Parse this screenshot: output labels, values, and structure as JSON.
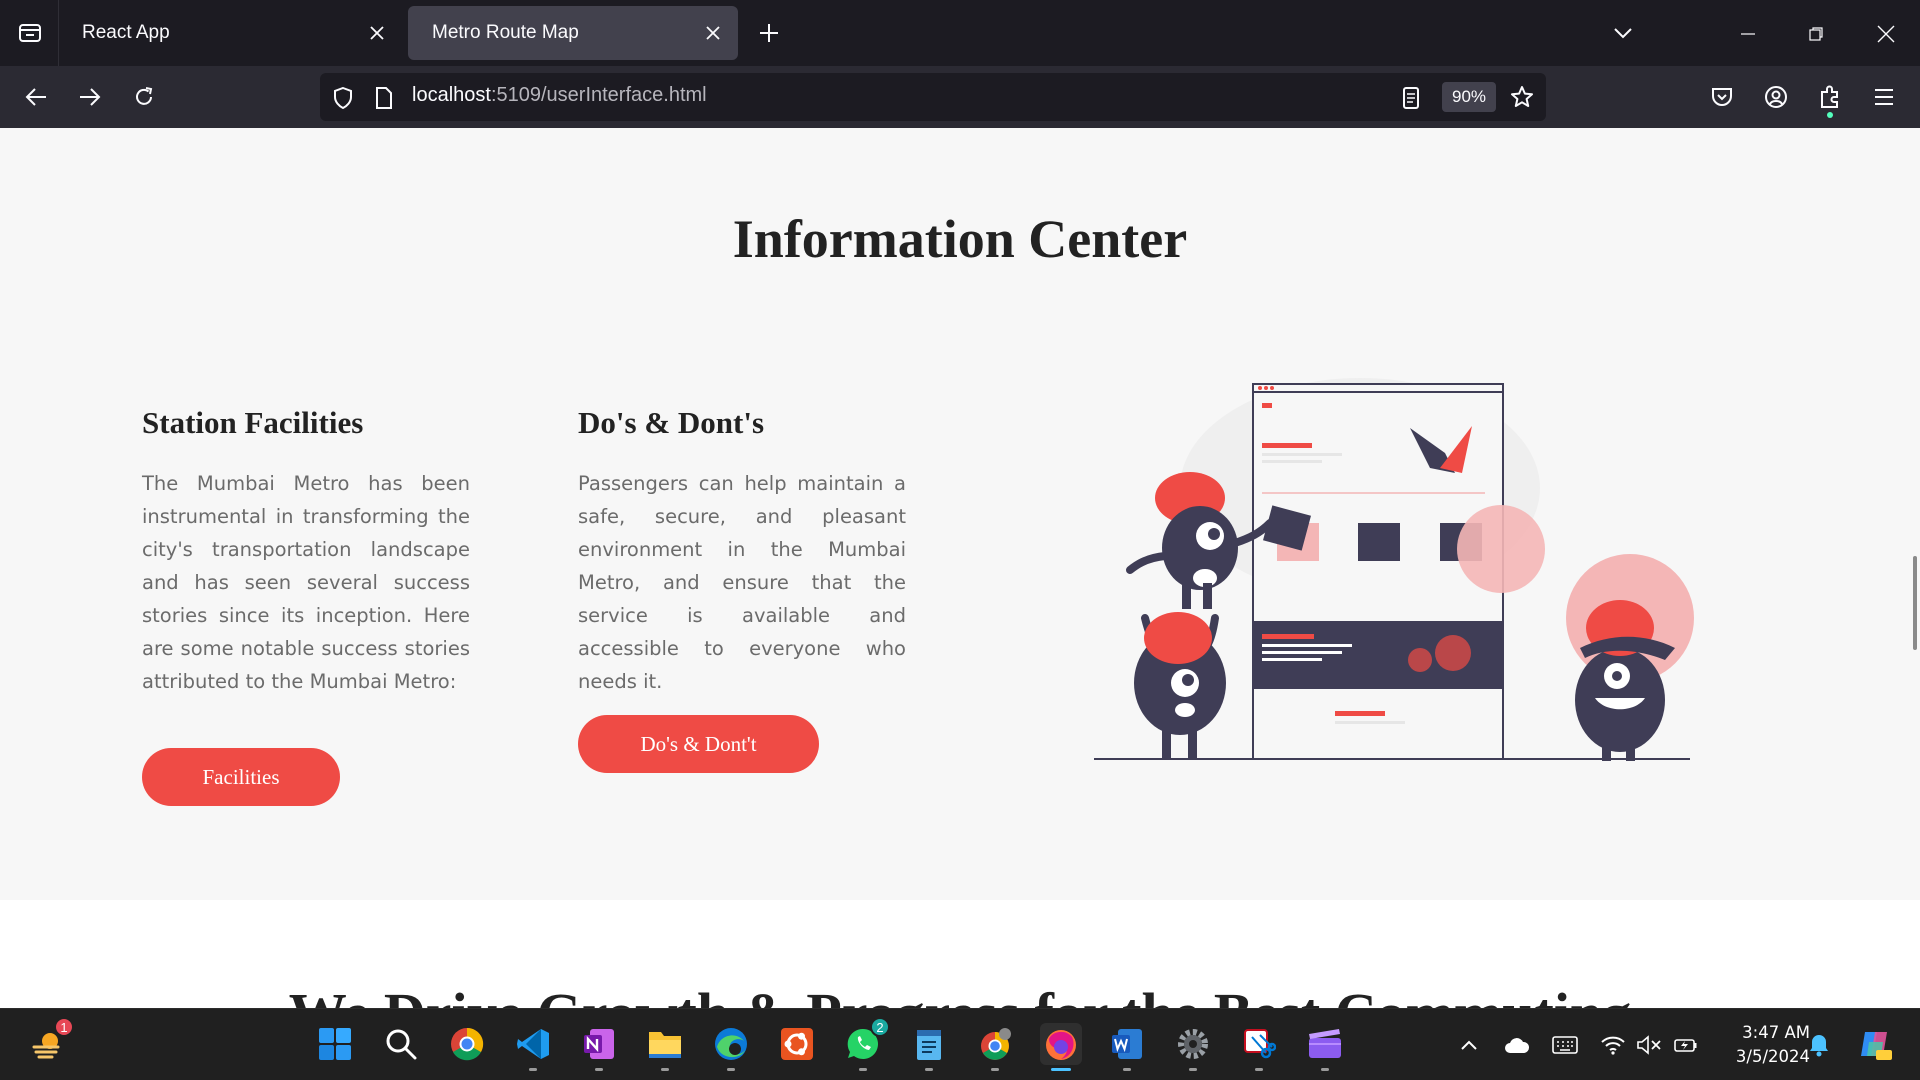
{
  "browser": {
    "tabs": [
      {
        "label": "React App",
        "active": false
      },
      {
        "label": "Metro Route Map",
        "active": true
      }
    ],
    "url_host": "localhost",
    "url_rest": ":5109/userInterface.html",
    "zoom": "90%"
  },
  "page": {
    "title": "Information Center",
    "columns": [
      {
        "heading": "Station Facilities",
        "body": "The Mumbai Metro has been instrumental in transforming the city's transportation landscape and has seen several success stories since its inception. Here are some notable success stories attributed to the Mumbai Metro:",
        "button": "Facilities"
      },
      {
        "heading": "Do's & Dont's",
        "body": "Passengers can help maintain a safe, secure, and pleasant environment in the Mumbai Metro, and ensure that the service is available and accessible to everyone who needs it.",
        "button": "Do's & Dont't"
      }
    ],
    "next_section_title": "We Drive Growth & Progress for the Best Commuting",
    "accent_color": "#ef4b45"
  },
  "taskbar": {
    "apps": [
      {
        "name": "widgets-icon",
        "badge": "1"
      },
      {
        "name": "start-icon"
      },
      {
        "name": "search-icon"
      },
      {
        "name": "chrome-icon"
      },
      {
        "name": "vscode-icon"
      },
      {
        "name": "onenote-icon"
      },
      {
        "name": "file-explorer-icon"
      },
      {
        "name": "edge-icon"
      },
      {
        "name": "ubuntu-icon"
      },
      {
        "name": "whatsapp-icon",
        "badge": "2"
      },
      {
        "name": "notepad-icon"
      },
      {
        "name": "chrome-profile-icon"
      },
      {
        "name": "firefox-icon",
        "active": true
      },
      {
        "name": "word-icon"
      },
      {
        "name": "settings-icon"
      },
      {
        "name": "snipping-tool-icon"
      },
      {
        "name": "clipchamp-icon"
      }
    ],
    "time": "3:47 AM",
    "date": "3/5/2024"
  }
}
